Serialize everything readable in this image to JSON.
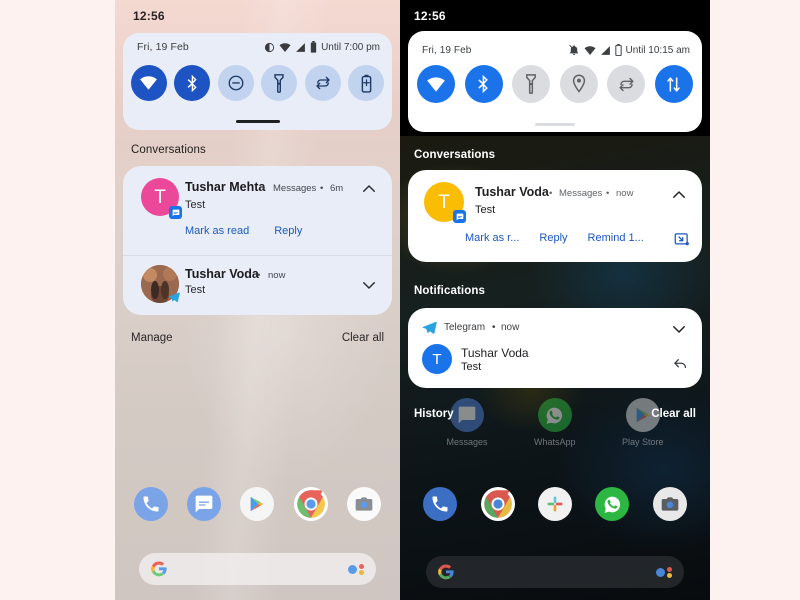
{
  "meta": {
    "accent_blue": "#1a73e8",
    "accent_blue_dark": "#1e53c4",
    "link_blue": "#1b5bbd",
    "page_background": "#fdf2f0"
  },
  "left_phone": {
    "theme": "light",
    "status_bar": {
      "clock": "12:56"
    },
    "quick_settings": {
      "date": "Fri, 19 Feb",
      "battery_status": "Until 7:00 pm",
      "status_icons": [
        "dnd-icon",
        "wifi-icon",
        "signal-icon",
        "battery-icon"
      ],
      "tiles": [
        {
          "name": "wifi-tile",
          "icon": "wifi-icon",
          "state": "on"
        },
        {
          "name": "bluetooth-tile",
          "icon": "bluetooth-icon",
          "state": "on"
        },
        {
          "name": "do-not-disturb-tile",
          "icon": "do-not-disturb-icon",
          "state": "off"
        },
        {
          "name": "flashlight-tile",
          "icon": "flashlight-icon",
          "state": "off"
        },
        {
          "name": "auto-rotate-tile",
          "icon": "auto-rotate-icon",
          "state": "off"
        },
        {
          "name": "battery-saver-tile",
          "icon": "battery-saver-icon",
          "state": "off"
        }
      ]
    },
    "sections": {
      "conversations_label": "Conversations"
    },
    "notifications": [
      {
        "name": "conversation-tushar-mehta",
        "title": "Tushar Mehta",
        "app": "Messages",
        "time": "6m",
        "separator": "•",
        "body": "Test",
        "avatar_letter": "T",
        "avatar_color": "#ec4899",
        "badge": "messages-icon",
        "expanded": true,
        "chevron": "chevron-up-icon",
        "actions": [
          "Mark as read",
          "Reply"
        ]
      },
      {
        "name": "conversation-tushar-voda",
        "title": "Tushar Voda",
        "app": "",
        "time": "now",
        "separator": "•",
        "body": "Test",
        "avatar_letter": "",
        "avatar_color": "#8d6a5a",
        "badge": "telegram-icon",
        "expanded": false,
        "chevron": "chevron-down-icon",
        "actions": []
      }
    ],
    "footer": {
      "left_label": "Manage",
      "right_label": "Clear all"
    },
    "dock": [
      {
        "name": "phone-app-icon",
        "label": ""
      },
      {
        "name": "messages-app-icon",
        "label": ""
      },
      {
        "name": "play-store-app-icon",
        "label": ""
      },
      {
        "name": "chrome-app-icon",
        "label": ""
      },
      {
        "name": "camera-app-icon",
        "label": ""
      }
    ],
    "search": {
      "logo": "google-g-icon",
      "assistant": "assistant-icon",
      "placeholder": ""
    }
  },
  "right_phone": {
    "theme": "dark",
    "status_bar": {
      "clock": "12:56"
    },
    "quick_settings": {
      "date": "Fri, 19 Feb",
      "battery_status": "Until 10:15 am",
      "status_icons": [
        "silent-bell-icon",
        "wifi-icon",
        "signal-icon",
        "battery-icon"
      ],
      "tiles": [
        {
          "name": "wifi-tile",
          "icon": "wifi-icon",
          "state": "on"
        },
        {
          "name": "bluetooth-tile",
          "icon": "bluetooth-icon",
          "state": "on"
        },
        {
          "name": "flashlight-tile",
          "icon": "flashlight-icon",
          "state": "off"
        },
        {
          "name": "location-tile",
          "icon": "location-icon",
          "state": "off"
        },
        {
          "name": "auto-rotate-tile",
          "icon": "auto-rotate-icon",
          "state": "off"
        },
        {
          "name": "mobile-data-tile",
          "icon": "mobile-data-icon",
          "state": "on"
        }
      ]
    },
    "sections": {
      "conversations_label": "Conversations",
      "notifications_label": "Notifications"
    },
    "conversation": {
      "name": "conversation-tushar-voda",
      "title": "Tushar Voda",
      "app": "Messages",
      "time": "now",
      "separator": "•",
      "body": "Test",
      "avatar_letter": "T",
      "avatar_color": "#fbbc04",
      "badge": "messages-icon",
      "chevron": "chevron-up-icon",
      "actions": [
        "Mark as r...",
        "Reply",
        "Remind 1..."
      ],
      "bubble_icon": "bubble-icon"
    },
    "notification": {
      "name": "notification-telegram",
      "app": "Telegram",
      "time": "now",
      "separator": "•",
      "app_icon": "telegram-icon",
      "chevron": "chevron-down-icon",
      "title": "Tushar Voda",
      "body": "Test",
      "avatar_letter": "T",
      "avatar_color": "#1a73e8",
      "reply_icon": "reply-arrow-icon"
    },
    "footer": {
      "left_label": "History",
      "right_label": "Clear all"
    },
    "background_apps": [
      {
        "name": "messages-app-icon",
        "label": "Messages"
      },
      {
        "name": "whatsapp-app-icon",
        "label": "WhatsApp"
      },
      {
        "name": "play-store-app-icon",
        "label": "Play Store"
      }
    ],
    "dock": [
      {
        "name": "phone-app-icon",
        "label": ""
      },
      {
        "name": "chrome-app-icon",
        "label": ""
      },
      {
        "name": "slack-app-icon",
        "label": ""
      },
      {
        "name": "whatsapp-app-icon",
        "label": ""
      },
      {
        "name": "camera-app-icon",
        "label": ""
      }
    ],
    "search": {
      "logo": "google-g-icon",
      "assistant": "assistant-icon",
      "placeholder": ""
    }
  }
}
